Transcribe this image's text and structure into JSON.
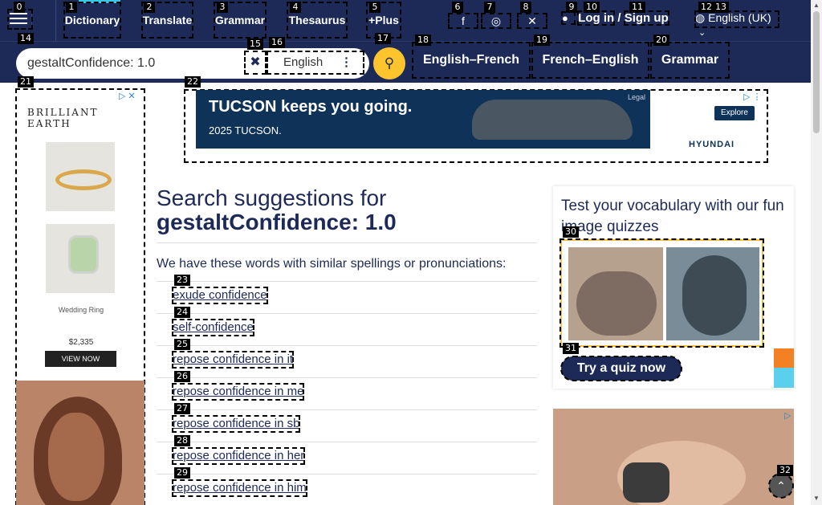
{
  "nav": {
    "links": [
      "Dictionary",
      "Translate",
      "Grammar",
      "Thesaurus",
      "+Plus"
    ],
    "login": "Log in",
    "slash": "/",
    "signup": "Sign up",
    "language": "English (UK)"
  },
  "search": {
    "value": "gestaltConfidence: 1.0",
    "dictionary": "English"
  },
  "subnav": [
    "English–French",
    "French–English",
    "Grammar"
  ],
  "left_ad": {
    "brand": "BRILLIANT EARTH",
    "caption": "Wedding Ring",
    "price": "$2,335",
    "cta": "VIEW NOW"
  },
  "top_ad": {
    "headline": "TUCSON keeps you going.",
    "subline": "2025 TUCSON.",
    "legal": "Legal",
    "cta": "Explore",
    "brand": "HYUNDAI"
  },
  "main": {
    "title_line1": "Search suggestions for",
    "title_line2": "gestaltConfidence: 1.0",
    "intro": "We have these words with similar spellings or pronunciations:",
    "suggestions": [
      "exude confidence",
      "self-confidence",
      "repose confidence in it",
      "repose confidence in me",
      "repose confidence in sb",
      "repose confidence in her",
      "repose confidence in him"
    ]
  },
  "quiz": {
    "title": "Test your vocabulary with our fun image quizzes",
    "cta": "Try a quiz now"
  },
  "som_labels": [
    "0",
    "1",
    "2",
    "3",
    "4",
    "5",
    "6",
    "7",
    "8",
    "9",
    "10",
    "11",
    "12",
    "13",
    "14",
    "15",
    "16",
    "17",
    "18",
    "19",
    "20",
    "21",
    "22",
    "23",
    "24",
    "25",
    "26",
    "27",
    "28",
    "29",
    "30",
    "31",
    "32"
  ],
  "colors": {
    "navy": "#1d2a57",
    "yellow": "#fec42d",
    "cyan": "#39c6e7"
  }
}
